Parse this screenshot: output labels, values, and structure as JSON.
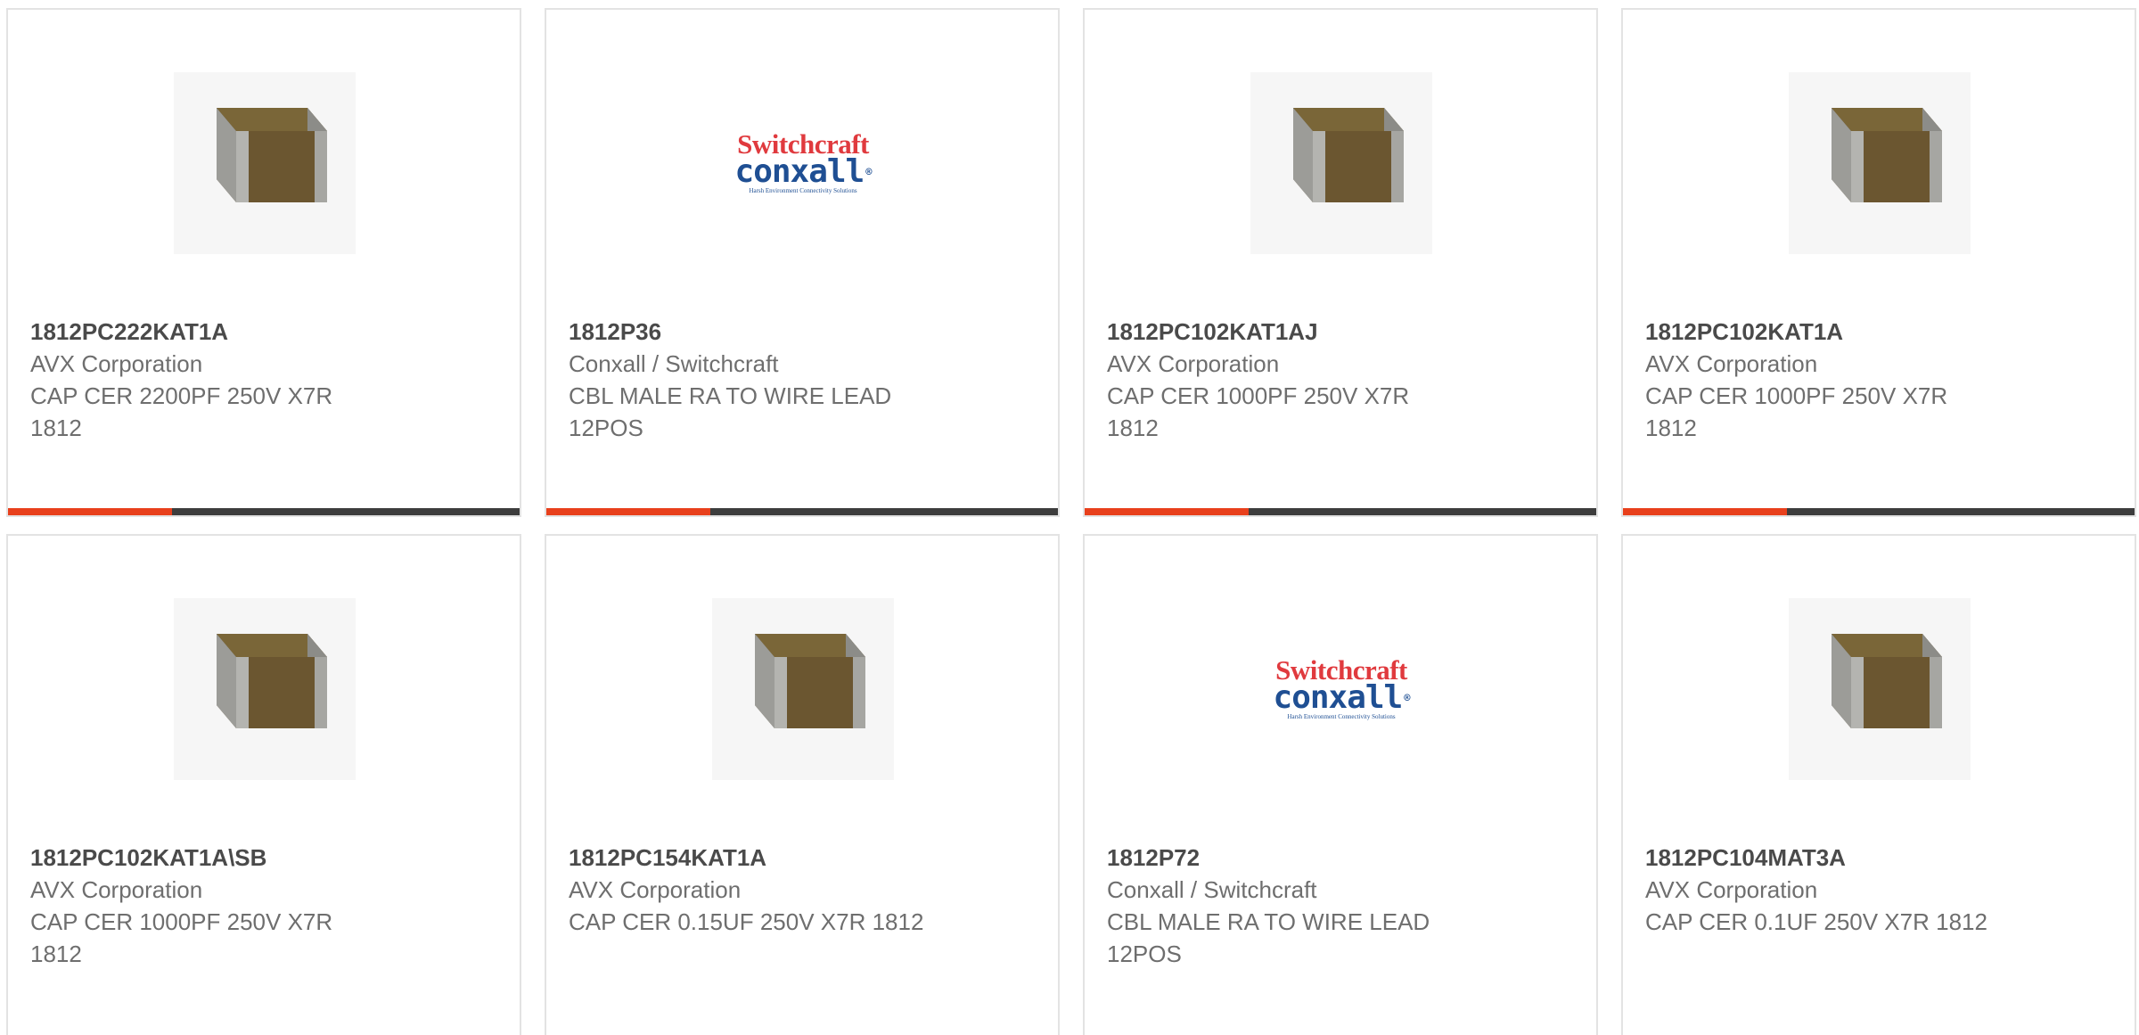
{
  "products": [
    {
      "part_number": "1812PC222KAT1A",
      "manufacturer": "AVX Corporation",
      "description": "CAP CER 2200PF 250V X7R 1812",
      "image": "ceramic-chip-capacitor"
    },
    {
      "part_number": "1812P36",
      "manufacturer": "Conxall / Switchcraft",
      "description": "CBL MALE RA TO WIRE LEAD 12POS",
      "image": "switchcraft-conxall-logo"
    },
    {
      "part_number": "1812PC102KAT1AJ",
      "manufacturer": "AVX Corporation",
      "description": "CAP CER 1000PF 250V X7R 1812",
      "image": "ceramic-chip-capacitor"
    },
    {
      "part_number": "1812PC102KAT1A",
      "manufacturer": "AVX Corporation",
      "description": "CAP CER 1000PF 250V X7R 1812",
      "image": "ceramic-chip-capacitor"
    },
    {
      "part_number": "1812PC102KAT1A\\SB",
      "manufacturer": "AVX Corporation",
      "description": "CAP CER 1000PF 250V X7R 1812",
      "image": "ceramic-chip-capacitor"
    },
    {
      "part_number": "1812PC154KAT1A",
      "manufacturer": "AVX Corporation",
      "description": "CAP CER 0.15UF 250V X7R 1812",
      "image": "ceramic-chip-capacitor"
    },
    {
      "part_number": "1812P72",
      "manufacturer": "Conxall / Switchcraft",
      "description": "CBL MALE RA TO WIRE LEAD 12POS",
      "image": "switchcraft-conxall-logo"
    },
    {
      "part_number": "1812PC104MAT3A",
      "manufacturer": "AVX Corporation",
      "description": "CAP CER 0.1UF 250V X7R 1812",
      "image": "ceramic-chip-capacitor"
    }
  ],
  "logo": {
    "line1": "Switchcraft",
    "line2": "conxall",
    "mark": "®",
    "tagline": "Harsh Environment Connectivity Solutions"
  },
  "colors": {
    "accent_bar": "#e8401c",
    "base_bar": "#3d3d3d",
    "card_border": "#e3e3e3",
    "part_text": "#4a4a4a",
    "secondary_text": "#6e6e6e",
    "logo_red": "#e03a3e",
    "logo_blue": "#1f4f93"
  }
}
